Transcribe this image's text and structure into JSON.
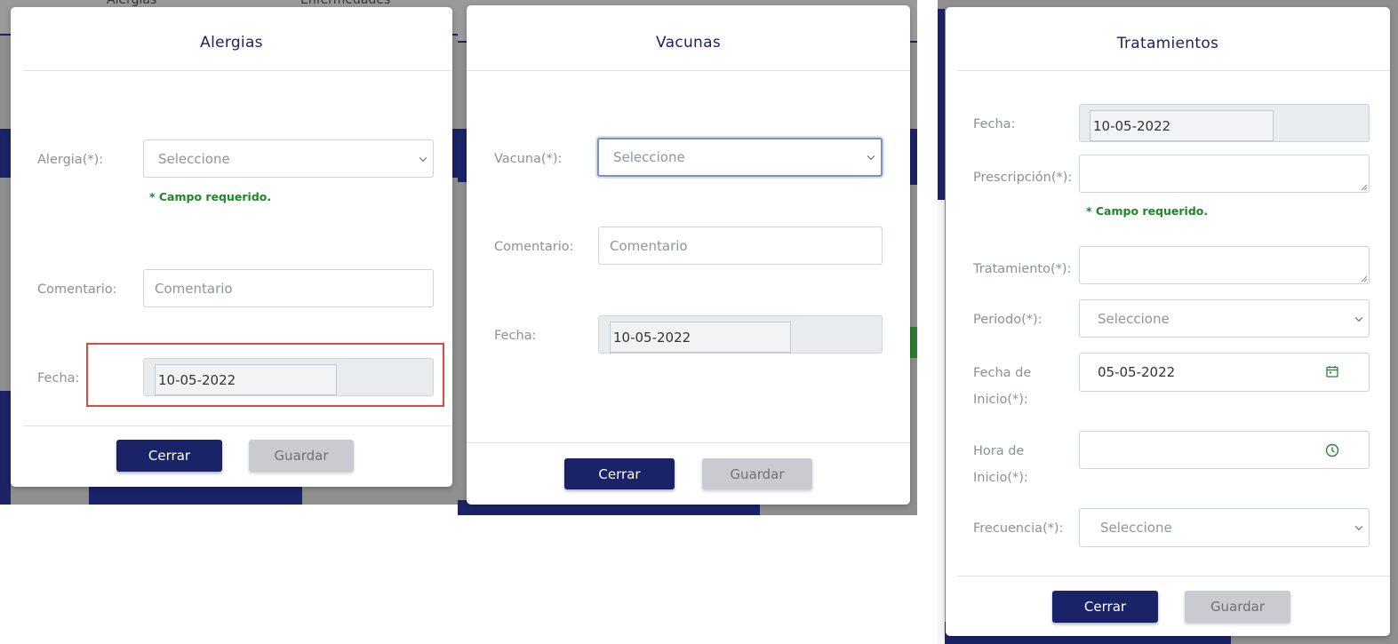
{
  "alergias": {
    "bg_tabs": [
      "Alergias",
      "Enfermedades"
    ],
    "title": "Alergias",
    "alergia_label": "Alergia(*):",
    "alergia_placeholder": "Seleccione",
    "required_msg": "* Campo requerido.",
    "comentario_label": "Comentario:",
    "comentario_placeholder": "Comentario",
    "fecha_label": "Fecha:",
    "fecha_value": "10-05-2022",
    "close_label": "Cerrar",
    "save_label": "Guardar"
  },
  "vacunas": {
    "title": "Vacunas",
    "vacuna_label": "Vacuna(*):",
    "vacuna_placeholder": "Seleccione",
    "comentario_label": "Comentario:",
    "comentario_placeholder": "Comentario",
    "fecha_label": "Fecha:",
    "fecha_value": "10-05-2022",
    "close_label": "Cerrar",
    "save_label": "Guardar"
  },
  "tratamientos": {
    "title": "Tratamientos",
    "fecha_label": "Fecha:",
    "fecha_value": "10-05-2022",
    "prescripcion_label": "Prescripción(*):",
    "required_msg": "* Campo requerido.",
    "tratamiento_label": "Tratamiento(*):",
    "periodo_label": "Periodo(*):",
    "periodo_placeholder": "Seleccione",
    "fecha_inicio_label_1": "Fecha de",
    "fecha_inicio_label_2": "Inicio(*):",
    "fecha_inicio_value": "05-05-2022",
    "hora_inicio_label_1": "Hora de",
    "hora_inicio_label_2": "Inicio(*):",
    "frecuencia_label": "Frecuencia(*):",
    "frecuencia_placeholder": "Seleccione",
    "close_label": "Cerrar",
    "save_label": "Guardar"
  },
  "colors": {
    "primary": "#1b2368",
    "required": "#198a28",
    "highlight": "#e2463d",
    "overlay": "#8f8f8f"
  }
}
